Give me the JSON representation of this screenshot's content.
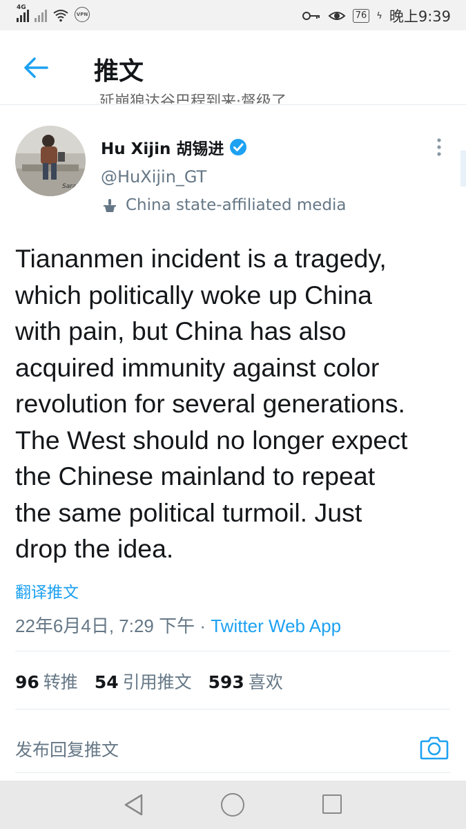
{
  "status_bar": {
    "network": "4G",
    "vpn_label": "VPN",
    "battery": "76",
    "time": "晚上9:39",
    "icons": [
      "signal-icon",
      "signal-dim-icon",
      "wifi-icon",
      "vpn-icon",
      "key-icon",
      "eye-icon",
      "battery-icon",
      "charging-icon"
    ]
  },
  "header": {
    "title": "推文",
    "back_icon": "back-arrow-icon",
    "clipped_text": "延崩狼达谷巴程到来·督级了"
  },
  "tweet": {
    "author_name": "Hu Xijin 胡锡进",
    "handle": "@HuXijin_GT",
    "affiliation": "China state-affiliated media",
    "avatar_caption": "Saraje",
    "text": "Tiananmen incident is a tragedy,\nwhich politically woke up China\nwith pain, but China has also\nacquired immunity against color\nrevolution for several generations.\nThe West should no longer expect\nthe Chinese mainland to repeat\nthe same political turmoil. Just\ndrop the idea.",
    "translate_label": "翻译推文",
    "timestamp": "22年6月4日, 7:29 下午 · ",
    "source": "Twitter Web App"
  },
  "stats": {
    "retweets_count": "96",
    "retweets_label": "转推",
    "quotes_count": "54",
    "quotes_label": "引用推文",
    "likes_count": "593",
    "likes_label": "喜欢"
  },
  "reply": {
    "placeholder": "发布回复推文",
    "camera_icon": "camera-icon"
  },
  "colors": {
    "accent": "#1da1f2",
    "secondary_text": "#657786",
    "primary_text": "#14171a"
  }
}
